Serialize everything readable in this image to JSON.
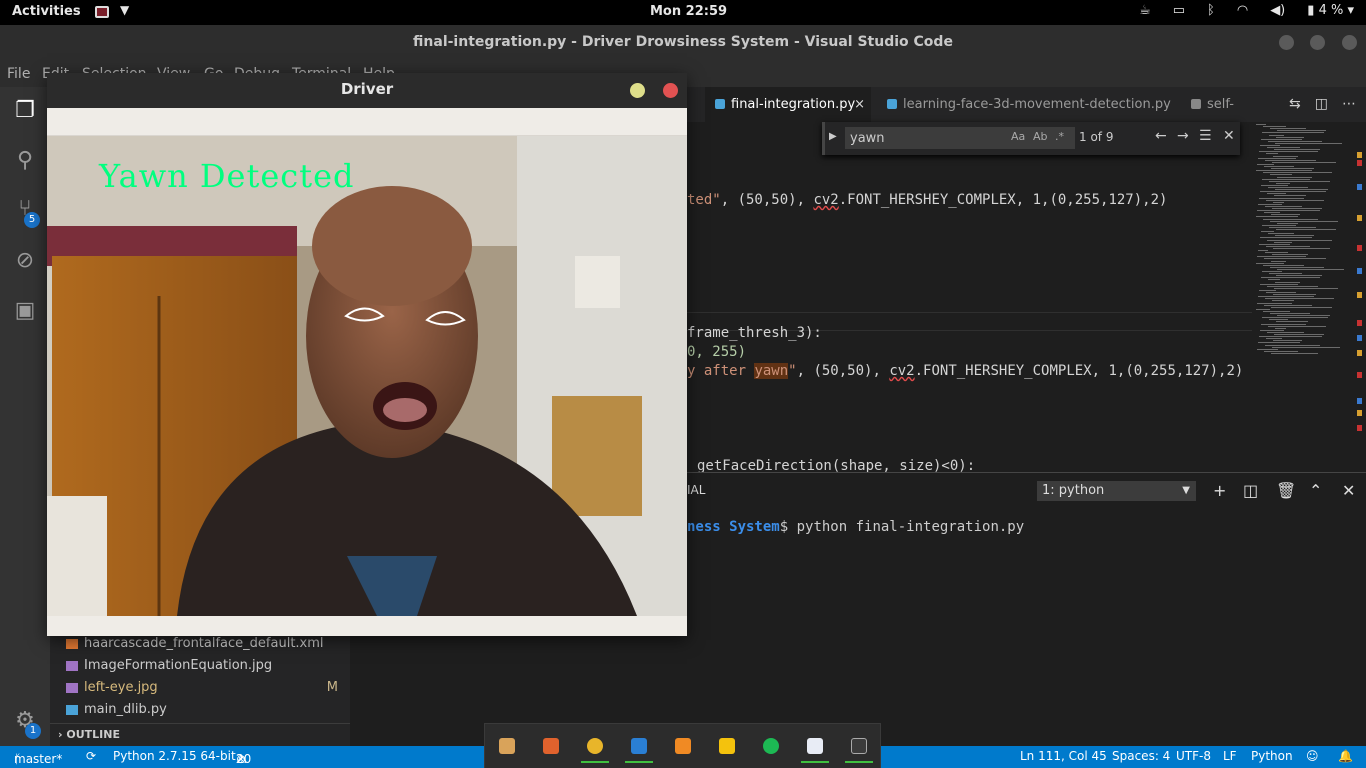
{
  "topbar": {
    "activities": "Activities",
    "clock": "Mon 22:59",
    "battery": "4 %",
    "battery_icon": "battery-icon",
    "icons": [
      "coffee-icon",
      "screen-icon",
      "bluetooth-icon",
      "wifi-icon",
      "volume-icon"
    ]
  },
  "window": {
    "title": "final-integration.py - Driver Drowsiness System - Visual Studio Code"
  },
  "menu": {
    "file": "File",
    "edit": "Edit",
    "selection": "Selection",
    "view": "View",
    "go": "Go",
    "debug": "Debug",
    "terminal": "Terminal",
    "help": "Help"
  },
  "activitybar": {
    "scm_badge": "5",
    "settings_badge": "1"
  },
  "tabs": [
    {
      "label": "final-integration.py",
      "close": "×"
    },
    {
      "label": "learning-face-3d-movement-detection.py"
    },
    {
      "label": "self-notes"
    }
  ],
  "find": {
    "query": "yawn",
    "case": "Aa",
    "word": "Ab",
    "regex": ".*",
    "result": "1 of 9",
    "prev": "←",
    "next": "→",
    "close": "✕"
  },
  "code": {
    "line1_str": "ted\"",
    "line1_rest": ", (50,50), ",
    "line1_font": "cv2",
    "line1_tail": ".FONT_HERSHEY_COMPLEX, 1,(0,255,127),2)",
    "line2": "frame_thresh_3):",
    "line3": "0, 255)",
    "line4_str_a": "y after ",
    "line4_match": "yawn",
    "line4_str_b": "\"",
    "line4_rest": ", (50,50), ",
    "line4_font": "cv2",
    "line4_tail": ".FONT_HERSHEY_COMPLEX, 1,(0,255,127),2)",
    "line5": "getFaceDirection(shape, size)<0):"
  },
  "panel": {
    "tab_label": "IAL",
    "terminal_select": "1: python",
    "prompt_path": "ness System",
    "prompt_symbol": "$",
    "command": " python final-integration.py"
  },
  "sidebar": {
    "files": [
      {
        "name": "haarcascade_frontalface_default.xml",
        "color": "#e37933"
      },
      {
        "name": "ImageFormationEquation.jpg",
        "color": "#a074c4"
      },
      {
        "name": "left-eye.jpg",
        "color": "#a074c4",
        "mark": "M"
      },
      {
        "name": "main_dlib.py",
        "color": "#4aa3d8"
      }
    ],
    "outline": "OUTLINE"
  },
  "driver": {
    "title": "Driver",
    "overlay_text": "Yawn Detected",
    "overlay_color": "#00ff7f"
  },
  "status": {
    "branch": "master*",
    "python": "Python 2.7.15 64-bit",
    "errors": "20",
    "warnings": "2",
    "position": "Ln 111, Col 45",
    "spaces": "Spaces: 4",
    "encoding": "UTF-8",
    "eol": "LF",
    "language": "Python"
  },
  "dock": {
    "apps": [
      "files-icon",
      "software-icon",
      "chrome-icon",
      "vscode-icon",
      "sublime-icon",
      "keep-icon",
      "spotify-icon",
      "docs-icon",
      "terminal-icon"
    ]
  }
}
